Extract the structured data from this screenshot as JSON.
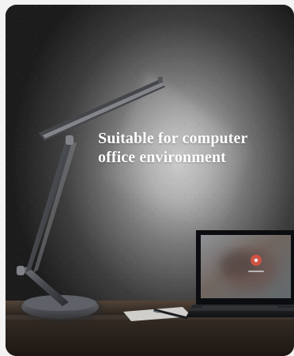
{
  "caption": {
    "line1": "Suitable for computer",
    "line2": "office environment"
  }
}
